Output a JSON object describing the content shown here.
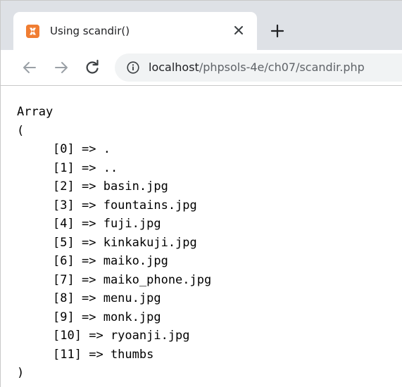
{
  "browser": {
    "tab": {
      "title": "Using scandir()",
      "favicon": "xampp-icon",
      "favicon_color": "#f07d32"
    },
    "toolbar": {
      "url_host": "localhost",
      "url_path": "/phpsols-4e/ch07/scandir.php"
    }
  },
  "page": {
    "open_label": "Array",
    "open_paren": "(",
    "close_paren": ")",
    "arrow": "=>",
    "entries": [
      {
        "key": "[0]",
        "value": "."
      },
      {
        "key": "[1]",
        "value": ".."
      },
      {
        "key": "[2]",
        "value": "basin.jpg"
      },
      {
        "key": "[3]",
        "value": "fountains.jpg"
      },
      {
        "key": "[4]",
        "value": "fuji.jpg"
      },
      {
        "key": "[5]",
        "value": "kinkakuji.jpg"
      },
      {
        "key": "[6]",
        "value": "maiko.jpg"
      },
      {
        "key": "[7]",
        "value": "maiko_phone.jpg"
      },
      {
        "key": "[8]",
        "value": "menu.jpg"
      },
      {
        "key": "[9]",
        "value": "monk.jpg"
      },
      {
        "key": "[10]",
        "value": "ryoanji.jpg"
      },
      {
        "key": "[11]",
        "value": "thumbs"
      }
    ]
  }
}
